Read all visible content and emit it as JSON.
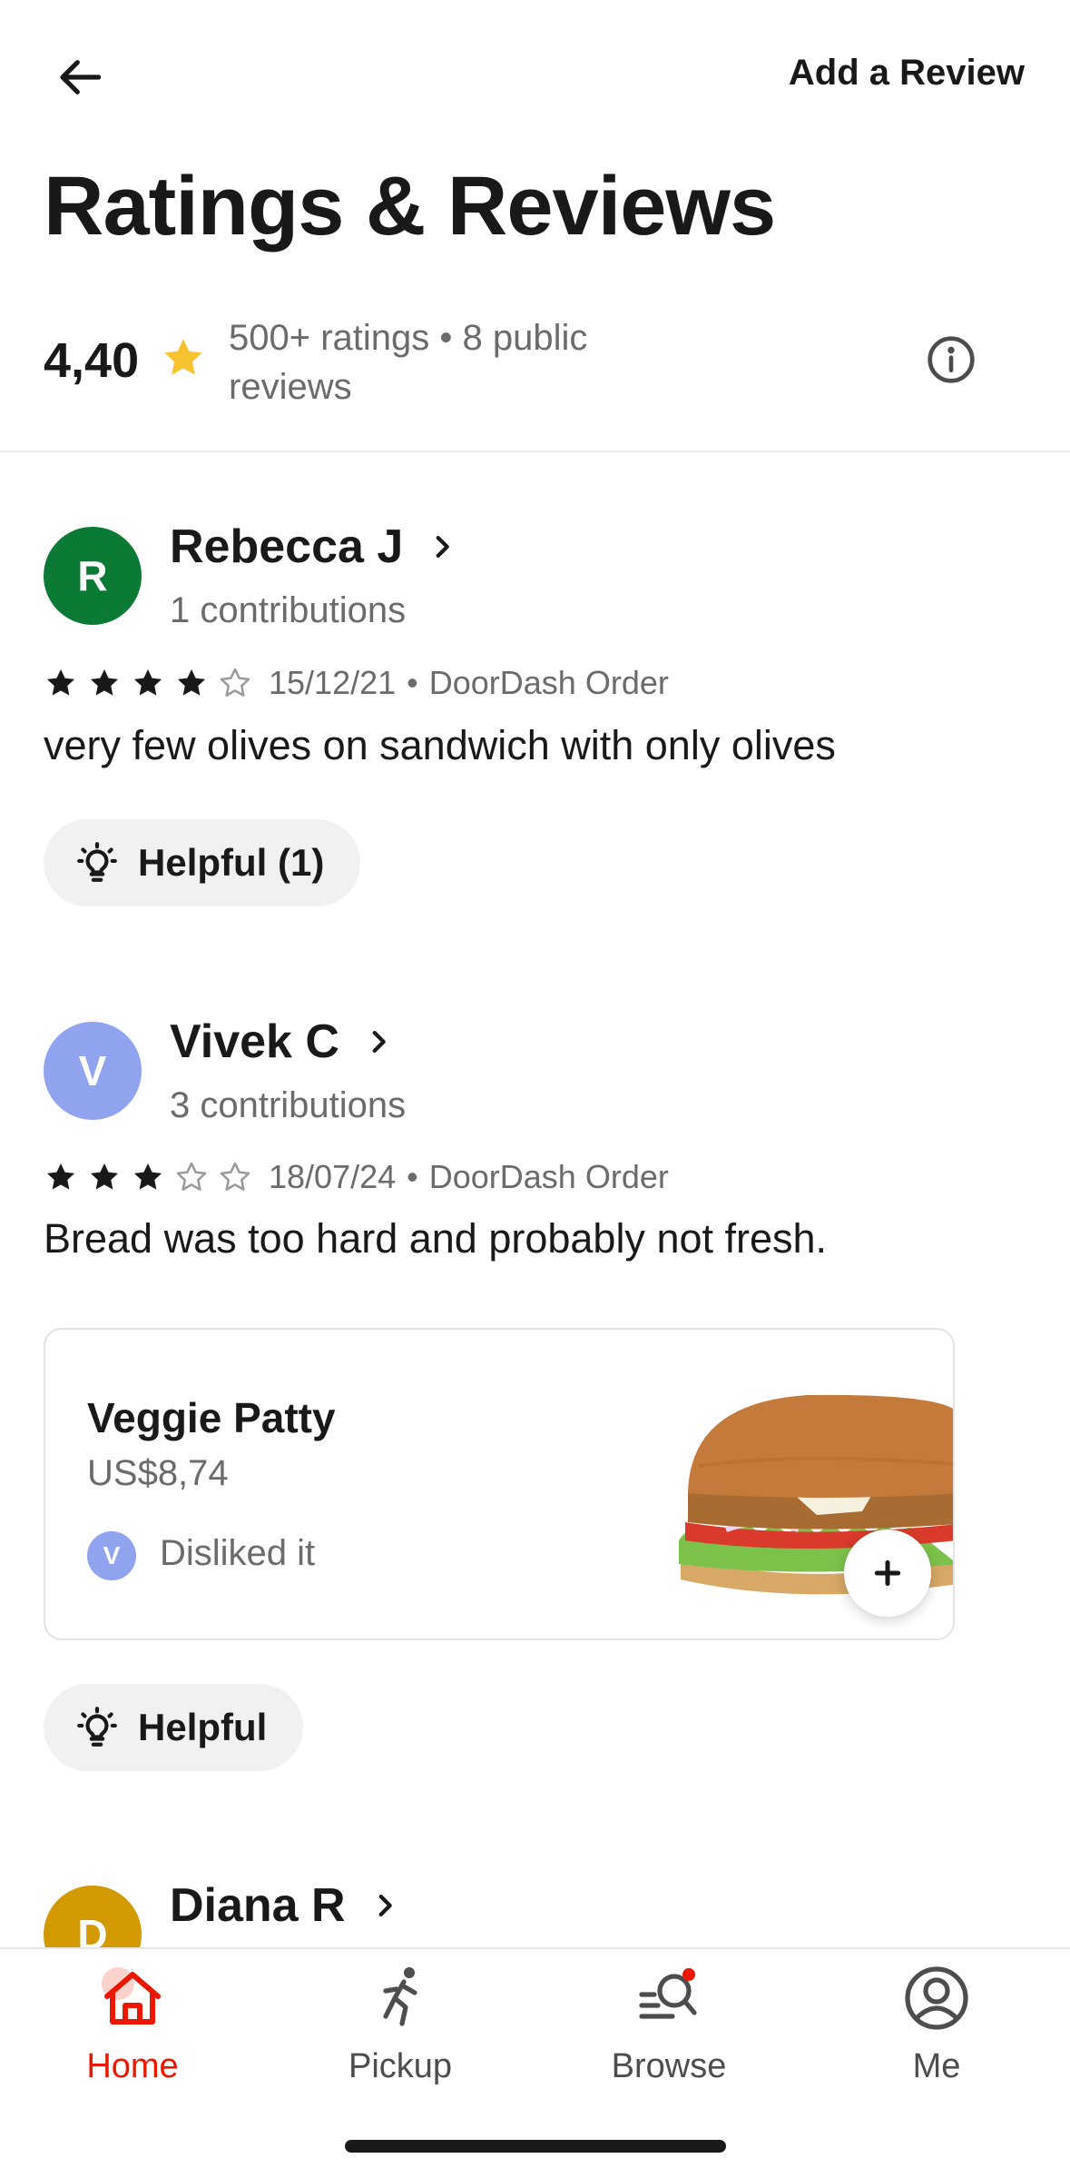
{
  "header": {
    "back_label": "back",
    "add_review": "Add a Review",
    "title": "Ratings & Reviews"
  },
  "summary": {
    "rating": "4,40",
    "text": "500+ ratings • 8 public reviews",
    "star_color": "#f7c42f"
  },
  "reviews": [
    {
      "initial": "R",
      "avatar_color": "#0b7a35",
      "name": "Rebecca J",
      "contributions": "1 contributions",
      "stars": 4,
      "date": "15/12/21",
      "source": "DoorDash Order",
      "text": "very few olives on sandwich with only olives",
      "helpful_label": "Helpful (1)"
    },
    {
      "initial": "V",
      "avatar_color": "#8fa3ef",
      "name": "Vivek C",
      "contributions": "3 contributions",
      "stars": 3,
      "date": "18/07/24",
      "source": "DoorDash Order",
      "text": "Bread was too hard and probably not fresh.",
      "helpful_label": "Helpful",
      "item": {
        "name": "Veggie Patty",
        "price": "US$8,74",
        "reviewer_initial": "V",
        "opinion": "Disliked it"
      }
    },
    {
      "initial": "D",
      "avatar_color": "#d29a00",
      "name": "Diana R"
    }
  ],
  "nav": {
    "active_color": "#eb1700",
    "items": [
      {
        "label": "Home",
        "icon": "home-icon"
      },
      {
        "label": "Pickup",
        "icon": "pickup-icon"
      },
      {
        "label": "Browse",
        "icon": "browse-icon"
      },
      {
        "label": "Me",
        "icon": "account-icon"
      }
    ]
  }
}
